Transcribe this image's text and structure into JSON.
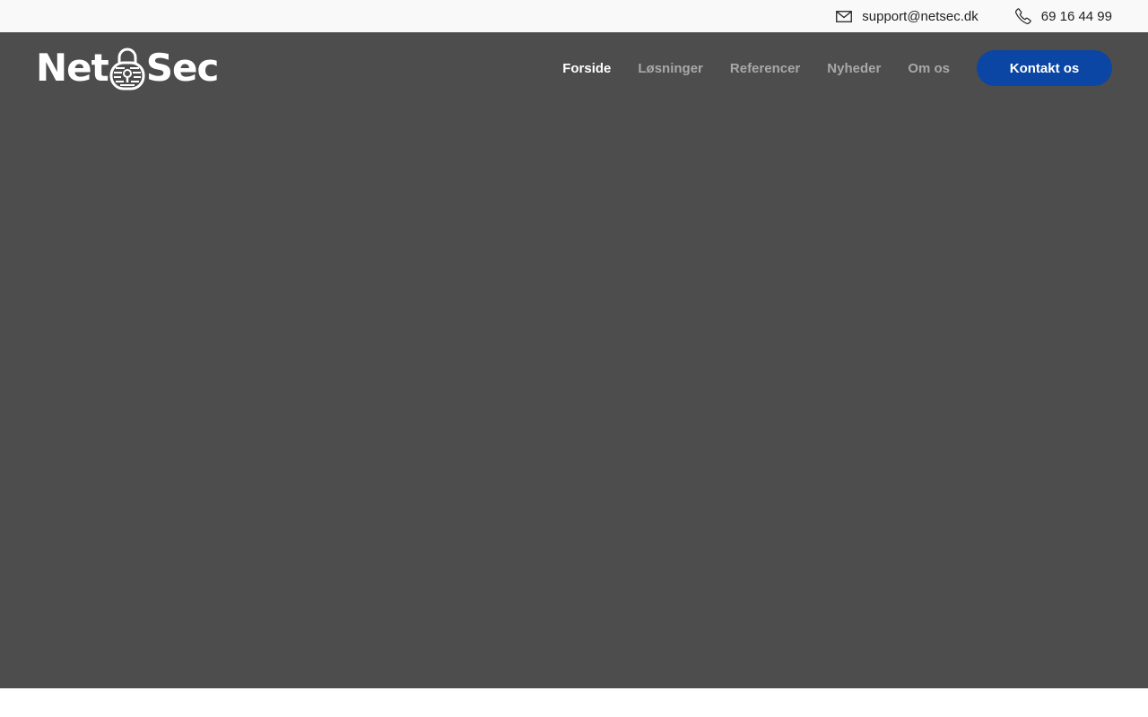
{
  "topbar": {
    "email": "support@netsec.dk",
    "email_icon": "mail-icon",
    "phone": "69 16 44 99",
    "phone_icon": "phone-icon"
  },
  "header": {
    "logo_left": "Net",
    "logo_right": "Sec",
    "logo_icon": "padlock-icon",
    "nav": [
      {
        "label": "Forside",
        "active": true
      },
      {
        "label": "Løsninger",
        "active": false
      },
      {
        "label": "Referencer",
        "active": false
      },
      {
        "label": "Nyheder",
        "active": false
      },
      {
        "label": "Om os",
        "active": false
      }
    ],
    "cta_label": "Kontakt os"
  },
  "colors": {
    "topbar_bg": "#f9f9f9",
    "hero_bg": "#4d4d4d",
    "cta_bg": "#0b46a4",
    "nav_inactive": "#a8a8a8",
    "nav_active": "#ffffff"
  }
}
